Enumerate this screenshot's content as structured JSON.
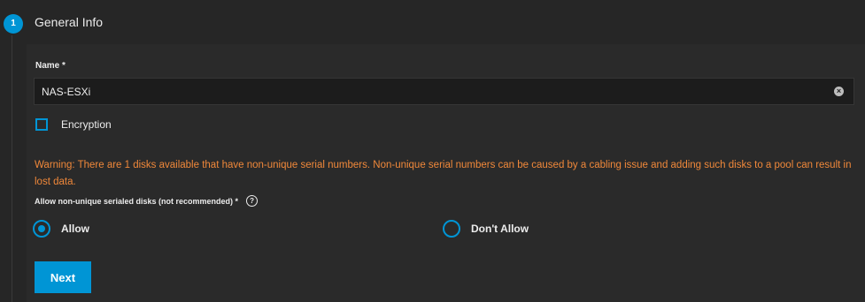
{
  "step": {
    "number": "1",
    "title": "General Info"
  },
  "name_field": {
    "label": "Name *",
    "value": "NAS-ESXi",
    "clear_icon": "clear-circle-icon"
  },
  "encryption": {
    "label": "Encryption",
    "checked": false
  },
  "warning": {
    "text": "Warning: There are 1 disks available that have non-unique serial numbers. Non-unique serial numbers can be caused by a cabling issue and adding such disks to a pool can result in lost data.",
    "color": "#f0883a"
  },
  "serial_radio": {
    "label": "Allow non-unique serialed disks (not recommended) *",
    "help_icon": "help-circle-icon",
    "options": [
      {
        "label": "Allow",
        "selected": true
      },
      {
        "label": "Don't Allow",
        "selected": false
      }
    ]
  },
  "actions": {
    "next_label": "Next"
  },
  "colors": {
    "accent": "#0095d5",
    "background": "#262626",
    "warning": "#f0883a"
  }
}
